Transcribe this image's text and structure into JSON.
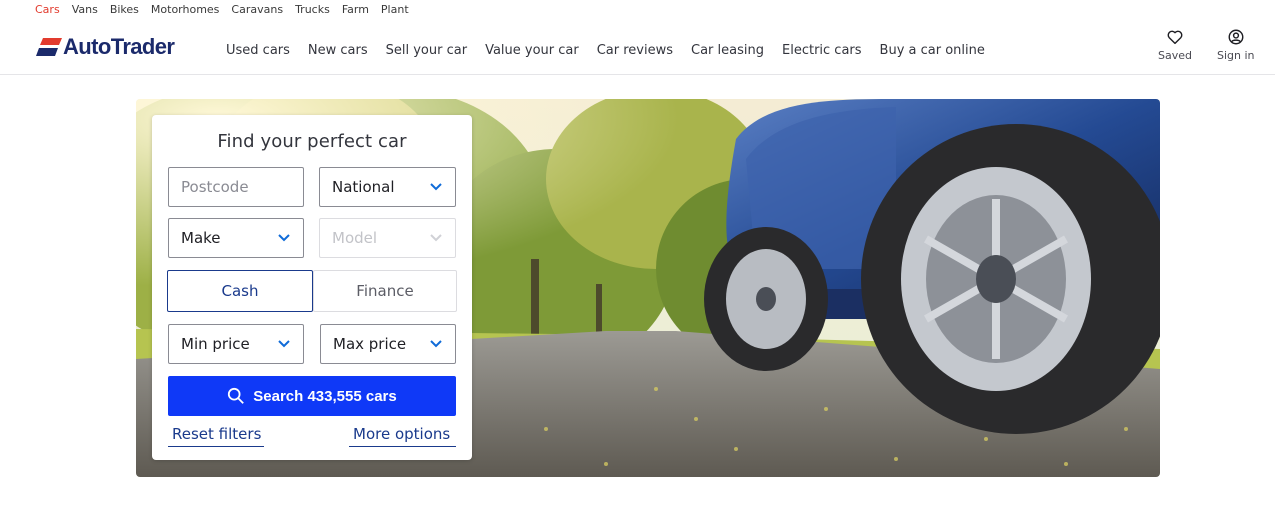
{
  "vehicle_types": [
    {
      "label": "Cars",
      "active": true
    },
    {
      "label": "Vans",
      "active": false
    },
    {
      "label": "Bikes",
      "active": false
    },
    {
      "label": "Motorhomes",
      "active": false
    },
    {
      "label": "Caravans",
      "active": false
    },
    {
      "label": "Trucks",
      "active": false
    },
    {
      "label": "Farm",
      "active": false
    },
    {
      "label": "Plant",
      "active": false
    }
  ],
  "header": {
    "logo_text": "AutoTrader",
    "nav": [
      "Used cars",
      "New cars",
      "Sell your car",
      "Value your car",
      "Car reviews",
      "Car leasing",
      "Electric cars",
      "Buy a car online"
    ],
    "saved_label": "Saved",
    "signin_label": "Sign in"
  },
  "search": {
    "title": "Find your perfect car",
    "postcode_placeholder": "Postcode",
    "distance_value": "National",
    "make_value": "Make",
    "model_value": "Model",
    "cash_label": "Cash",
    "finance_label": "Finance",
    "min_price": "Min price",
    "max_price": "Max price",
    "search_button": "Search 433,555 cars",
    "reset_label": "Reset filters",
    "more_options_label": "More options"
  },
  "colors": {
    "accent": "#0f39f7",
    "brand_navy": "#1b2a6b",
    "brand_red": "#e23b2e",
    "link": "#1a3a8c"
  },
  "icons": [
    "heart-icon",
    "user-circle-icon",
    "search-icon",
    "chevron-down-icon"
  ]
}
